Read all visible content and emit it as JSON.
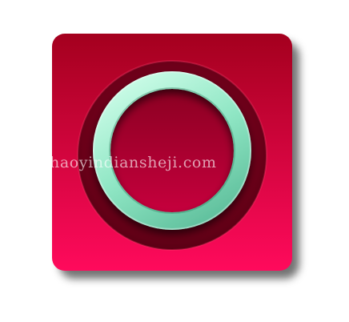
{
  "watermark": {
    "text": "haoyindiansheji.com"
  },
  "icon": {
    "name": "ring-icon",
    "colors": {
      "background_top": "#a4001e",
      "background_bottom": "#ff0a5c",
      "well_dark": "#6a0018",
      "inner_fill": "#b8003a",
      "ring_light": "#c9fbe6",
      "ring_mid": "#8fe6c4",
      "ring_dark": "#5fbf9c"
    }
  }
}
